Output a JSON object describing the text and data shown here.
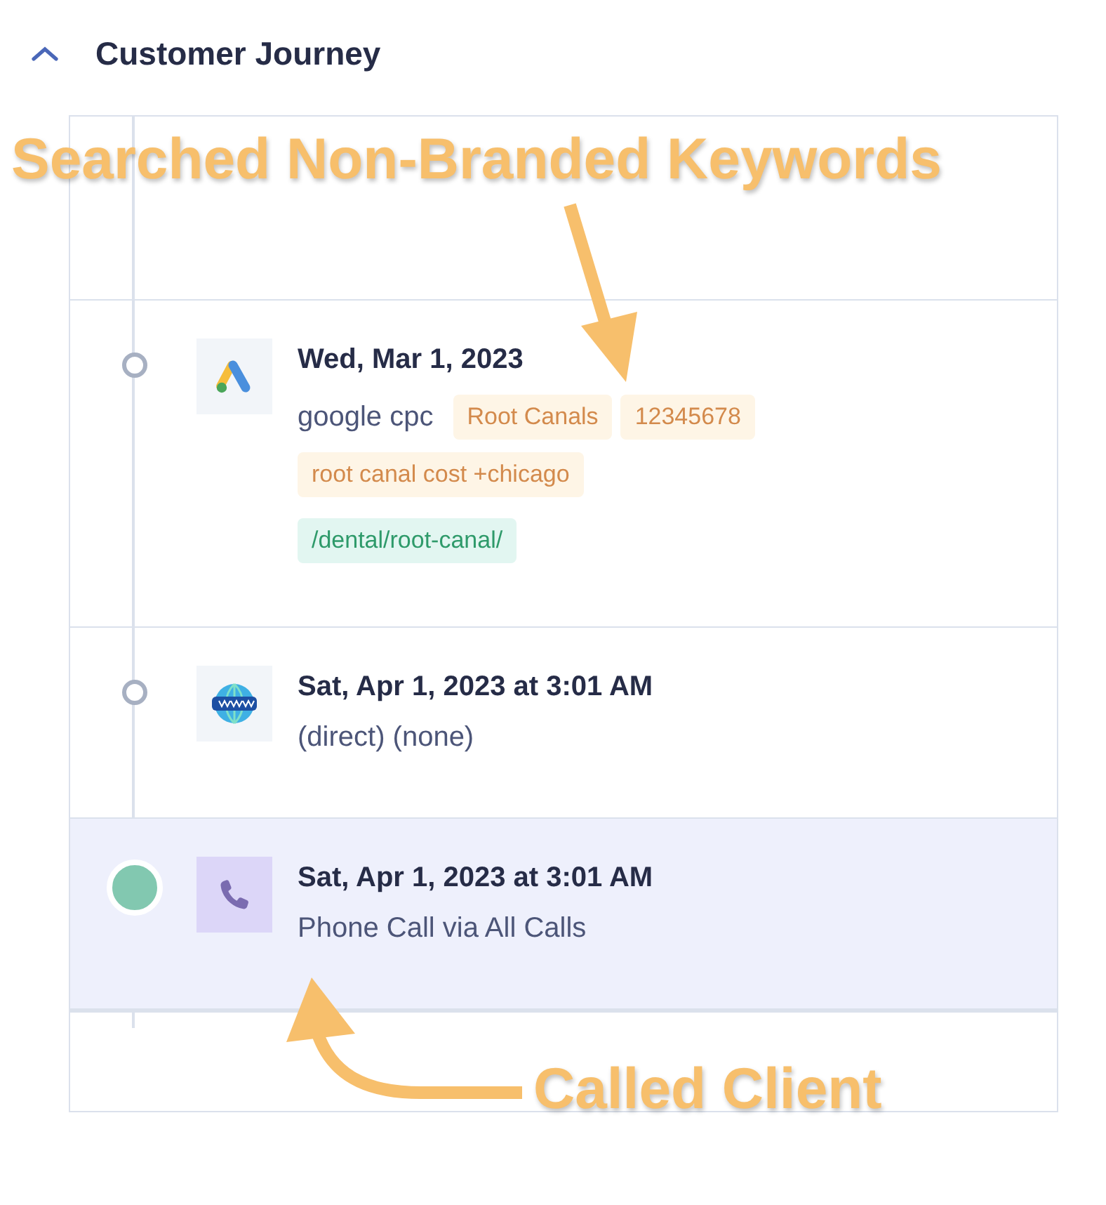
{
  "header": {
    "title": "Customer Journey",
    "expanded": true
  },
  "events": [
    {
      "kind": "ads",
      "date": "Wed, Mar 1, 2023",
      "source": "google cpc",
      "selected": false,
      "tags": [
        "Root Canals",
        "12345678",
        "root canal cost +chicago"
      ],
      "landing_page": "/dental/root-canal/"
    },
    {
      "kind": "web",
      "date": "Sat, Apr 1, 2023 at 3:01 AM",
      "source": "(direct) (none)",
      "selected": false
    },
    {
      "kind": "call",
      "date": "Sat, Apr 1, 2023 at 3:01 AM",
      "source": "Phone Call via All Calls",
      "selected": true
    }
  ],
  "annotations": [
    {
      "text": "Searched Non-Branded Keywords"
    },
    {
      "text": "Called Client"
    }
  ]
}
